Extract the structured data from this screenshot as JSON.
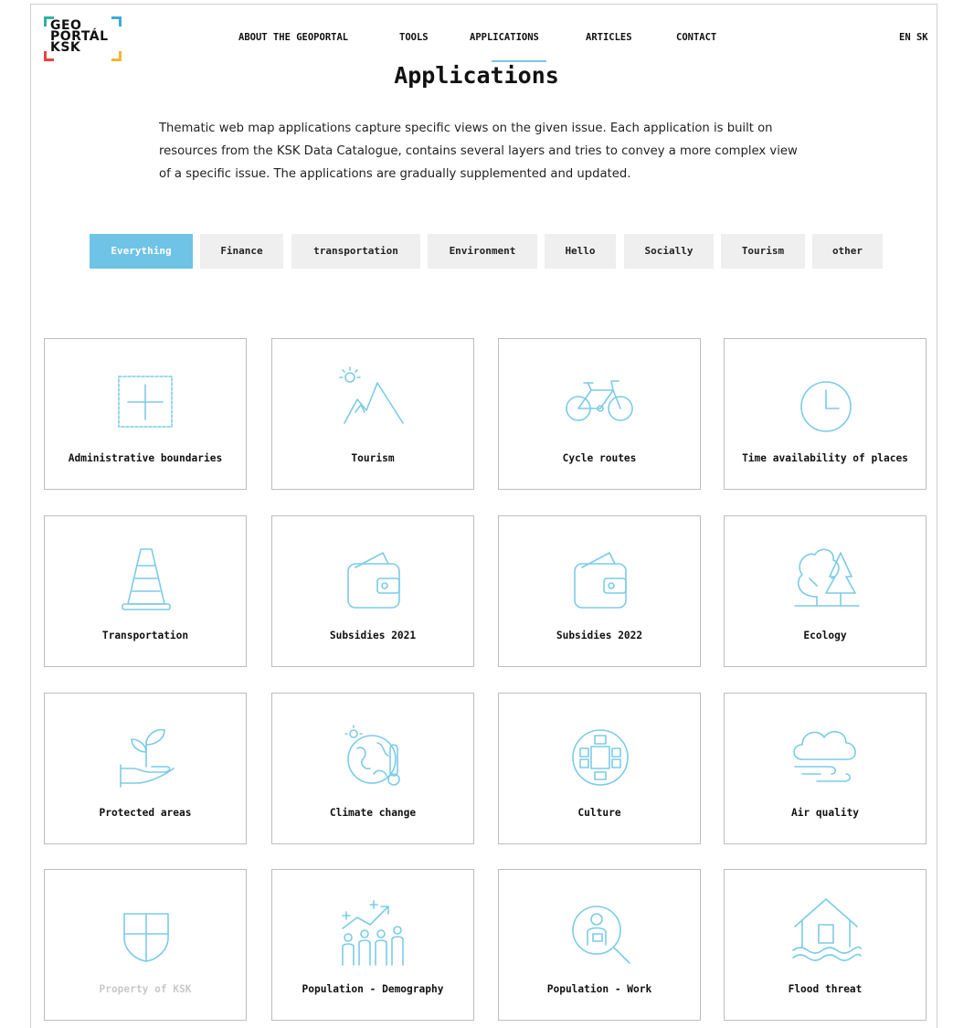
{
  "logo": {
    "text": "GEO\nPORTÁL\nKSK"
  },
  "nav": [
    {
      "label": "ABOUT THE GEOPORTAL"
    },
    {
      "label": "TOOLS"
    },
    {
      "label": "APPLICATIONS"
    },
    {
      "label": "ARTICLES"
    },
    {
      "label": "CONTACT"
    }
  ],
  "lang": {
    "en": "EN",
    "sk": "SK"
  },
  "page": {
    "title": "Applications",
    "intro": [
      "Thematic web map applications capture specific views on the given issue. Each application is built on",
      "resources from the KSK Data Catalogue, contains several layers and tries to convey a more complex view",
      "of a specific issue. The applications are gradually supplemented and updated."
    ]
  },
  "filters": [
    {
      "label": "Everything",
      "active": true
    },
    {
      "label": "Finance"
    },
    {
      "label": "transportation"
    },
    {
      "label": "Environment"
    },
    {
      "label": "Hello"
    },
    {
      "label": "Socially"
    },
    {
      "label": "Tourism"
    },
    {
      "label": "other"
    }
  ],
  "apps": [
    {
      "label": "Administrative boundaries",
      "icon": "crosshair-box-icon"
    },
    {
      "label": "Tourism",
      "icon": "mountain-sun-icon"
    },
    {
      "label": "Cycle routes",
      "icon": "bicycle-icon"
    },
    {
      "label": "Time availability of places",
      "icon": "clock-icon"
    },
    {
      "label": "Transportation",
      "icon": "traffic-cone-icon"
    },
    {
      "label": "Subsidies 2021",
      "icon": "wallet-icon"
    },
    {
      "label": "Subsidies 2022",
      "icon": "wallet-icon"
    },
    {
      "label": "Ecology",
      "icon": "trees-icon"
    },
    {
      "label": "Protected areas",
      "icon": "hand-plant-icon"
    },
    {
      "label": "Climate change",
      "icon": "globe-thermometer-icon"
    },
    {
      "label": "Culture",
      "icon": "culture-circle-icon"
    },
    {
      "label": "Air quality",
      "icon": "cloud-wind-icon"
    },
    {
      "label": "Property of KSK",
      "icon": "shield-icon",
      "muted": true
    },
    {
      "label": "Population - Demography",
      "icon": "people-growth-icon"
    },
    {
      "label": "Population - Work",
      "icon": "magnifier-person-icon"
    },
    {
      "label": "Flood threat",
      "icon": "house-flood-icon"
    }
  ],
  "colors": {
    "accent": "#6fc3e6",
    "icon_stroke": "#7ccbe8",
    "filter_bg": "#efefef"
  }
}
